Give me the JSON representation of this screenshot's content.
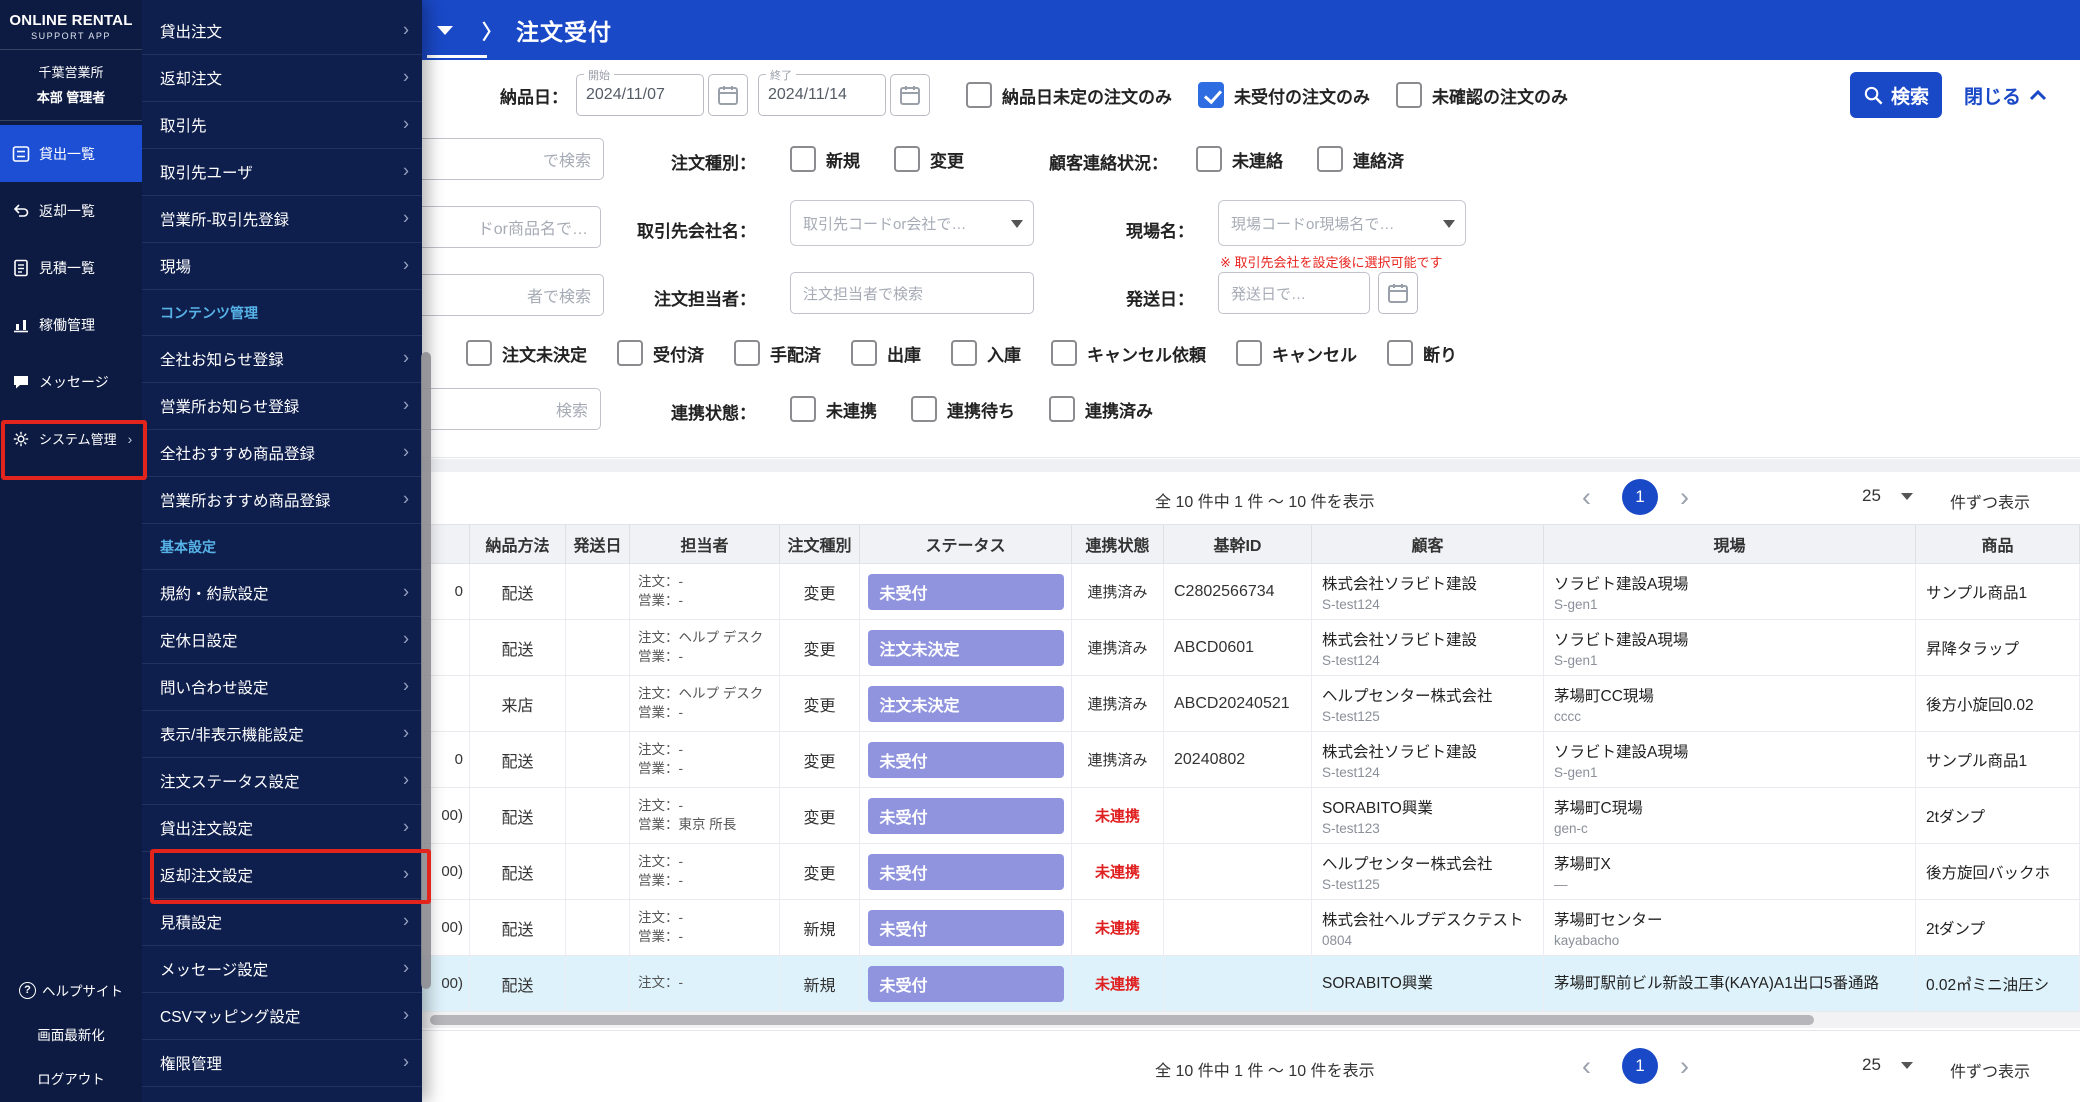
{
  "colors": {
    "accent_blue": "#1a49c8",
    "sidebar_navy": "#0d1b42",
    "badge_purple": "#9094de",
    "alert_red": "#e3241d",
    "link_red": "#e02020"
  },
  "sidebar": {
    "logo_line1": "ONLINE RENTAL",
    "logo_line2": "SUPPORT APP",
    "office": "千葉営業所",
    "role": "本部 管理者",
    "items": [
      {
        "label": "貸出一覧"
      },
      {
        "label": "返却一覧"
      },
      {
        "label": "見積一覧"
      },
      {
        "label": "稼働管理"
      },
      {
        "label": "メッセージ"
      },
      {
        "label": "システム管理"
      }
    ],
    "footer": [
      {
        "label": "ヘルプサイト"
      },
      {
        "label": "画面最新化"
      },
      {
        "label": "ログアウト"
      }
    ]
  },
  "submenu": {
    "top_items": [
      "貸出注文",
      "返却注文",
      "取引先",
      "取引先ユーザ",
      "営業所-取引先登録",
      "現場"
    ],
    "content_section": "コンテンツ管理",
    "content_items": [
      "全社お知らせ登録",
      "営業所お知らせ登録",
      "全社おすすめ商品登録",
      "営業所おすすめ商品登録"
    ],
    "basic_section": "基本設定",
    "basic_items": [
      "規約・約款設定",
      "定休日設定",
      "問い合わせ設定",
      "表示/非表示機能設定",
      "注文ステータス設定",
      "貸出注文設定",
      "返却注文設定",
      "見積設定",
      "メッセージ設定",
      "CSVマッピング設定",
      "権限管理"
    ]
  },
  "header": {
    "breadcrumb_chevron": "〉",
    "title": "注文受付"
  },
  "filters": {
    "delivery_date_label": "納品日：",
    "date_start_legend": "開始",
    "date_start_value": "2024/11/07",
    "date_end_legend": "終了",
    "date_end_value": "2024/11/14",
    "chk_no_delivery_date": "納品日未定の注文のみ",
    "chk_unaccepted": "未受付の注文のみ",
    "chk_unconfirmed": "未確認の注文のみ",
    "order_type_label": "注文種別：",
    "chk_new": "新規",
    "chk_change": "変更",
    "contact_label": "顧客連絡状況：",
    "chk_not_contacted": "未連絡",
    "chk_contacted": "連絡済",
    "partner_label": "取引先会社名：",
    "partner_placeholder": "取引先コードor会社で…",
    "site_label": "現場名：",
    "site_placeholder": "現場コードor現場名で…",
    "site_note": "※ 取引先会社を設定後に選択可能です",
    "staff_label": "注文担当者：",
    "staff_placeholder": "注文担当者で検索",
    "ship_label": "発送日：",
    "ship_placeholder": "発送日で…",
    "status_checks": [
      "注文未決定",
      "受付済",
      "手配済",
      "出庫",
      "入庫",
      "キャンセル依頼",
      "キャンセル",
      "断り"
    ],
    "link_label": "連携状態：",
    "link_checks": [
      "未連携",
      "連携待ち",
      "連携済み"
    ],
    "cut_placeholder_1": "で検索",
    "cut_placeholder_2": "ドor商品名で…",
    "cut_placeholder_3": "者で検索",
    "cut_placeholder_4": "検索",
    "search_button": "検索",
    "close_button": "閉じる"
  },
  "pagination": {
    "count_text": "全 10 件中 1 件 ～ 10 件を表示",
    "page": "1",
    "per_page": "25",
    "per_page_suffix": "件ずつ表示"
  },
  "table": {
    "headers": [
      "納品方法",
      "発送日",
      "担当者",
      "注文種別",
      "ステータス",
      "連携状態",
      "基幹ID",
      "顧客",
      "現場",
      "商品"
    ],
    "rows": [
      {
        "cut": "0",
        "delivery": "配送",
        "ship_date": "",
        "staff_line1": "注文：-",
        "staff_line2": "営業：-",
        "order_type": "変更",
        "status": "未受付",
        "link": "連携済み",
        "core_id": "C2802566734",
        "customer": "株式会社ソラビト建設",
        "customer_sub": "S-test124",
        "site": "ソラビト建設A現場",
        "site_sub": "S-gen1",
        "product": "サンプル商品1"
      },
      {
        "cut": "",
        "delivery": "配送",
        "ship_date": "",
        "staff_line1": "注文：ヘルプ デスク",
        "staff_line2": "営業：-",
        "order_type": "変更",
        "status": "注文未決定",
        "link": "連携済み",
        "core_id": "ABCD0601",
        "customer": "株式会社ソラビト建設",
        "customer_sub": "S-test124",
        "site": "ソラビト建設A現場",
        "site_sub": "S-gen1",
        "product": "昇降タラップ"
      },
      {
        "cut": "",
        "delivery": "来店",
        "ship_date": "",
        "staff_line1": "注文：ヘルプ デスク",
        "staff_line2": "営業：-",
        "order_type": "変更",
        "status": "注文未決定",
        "link": "連携済み",
        "core_id": "ABCD20240521",
        "customer": "ヘルプセンター株式会社",
        "customer_sub": "S-test125",
        "site": "茅場町CC現場",
        "site_sub": "cccc",
        "product": "後方小旋回0.02"
      },
      {
        "cut": "0",
        "delivery": "配送",
        "ship_date": "",
        "staff_line1": "注文：-",
        "staff_line2": "営業：-",
        "order_type": "変更",
        "status": "未受付",
        "link": "連携済み",
        "core_id": "20240802",
        "customer": "株式会社ソラビト建設",
        "customer_sub": "S-test124",
        "site": "ソラビト建設A現場",
        "site_sub": "S-gen1",
        "product": "サンプル商品1"
      },
      {
        "cut": "00)",
        "delivery": "配送",
        "ship_date": "",
        "staff_line1": "注文：-",
        "staff_line2": "営業：東京 所長",
        "order_type": "変更",
        "status": "未受付",
        "link": "未連携",
        "core_id": "",
        "customer": "SORABITO興業",
        "customer_sub": "S-test123",
        "site": "茅場町C現場",
        "site_sub": "gen-c",
        "product": "2tダンプ"
      },
      {
        "cut": "00)",
        "delivery": "配送",
        "ship_date": "",
        "staff_line1": "注文：-",
        "staff_line2": "営業：-",
        "order_type": "変更",
        "status": "未受付",
        "link": "未連携",
        "core_id": "",
        "customer": "ヘルプセンター株式会社",
        "customer_sub": "S-test125",
        "site": "茅場町X",
        "site_sub": "—",
        "product": "後方旋回バックホ"
      },
      {
        "cut": "00)",
        "delivery": "配送",
        "ship_date": "",
        "staff_line1": "注文：-",
        "staff_line2": "営業：-",
        "order_type": "新規",
        "status": "未受付",
        "link": "未連携",
        "core_id": "",
        "customer": "株式会社ヘルプデスクテスト",
        "customer_sub": "0804",
        "site": "茅場町センター",
        "site_sub": "kayabacho",
        "product": "2tダンプ"
      },
      {
        "cut": "00)",
        "delivery": "配送",
        "ship_date": "",
        "staff_line1": "注文：-",
        "staff_line2": "",
        "order_type": "新規",
        "status": "未受付",
        "link": "未連携",
        "core_id": "",
        "customer": "SORABITO興業",
        "customer_sub": "",
        "site": "茅場町駅前ビル新設工事(KAYA)A1出口5番通路",
        "site_sub": "",
        "product": "0.02㎥ミニ油圧シ"
      }
    ]
  }
}
